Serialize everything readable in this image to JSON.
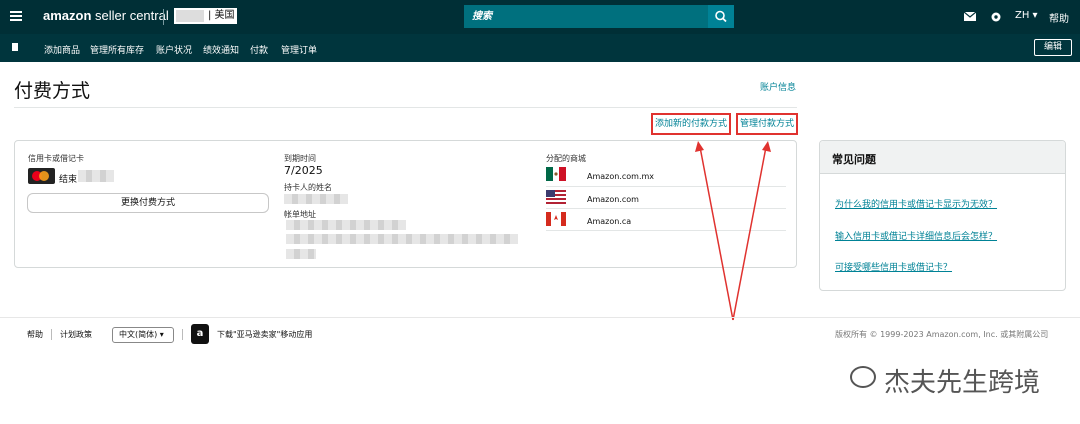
{
  "header": {
    "logo_text_1": "amazon",
    "logo_text_2": " seller central",
    "store_region": "| 美国",
    "search_placeholder": "搜索",
    "lang": "ZH ▾",
    "help": "帮助"
  },
  "nav": {
    "items": [
      "添加商品",
      "管理所有库存",
      "账户状况",
      "绩效通知",
      "付款",
      "管理订单"
    ],
    "edit": "编辑"
  },
  "page": {
    "title": "付费方式",
    "account_info": "账户信息",
    "add_method": "添加新的付款方式",
    "manage_method": "管理付款方式"
  },
  "card": {
    "cc_label": "信用卡或借记卡",
    "cc_ending": "结束",
    "replace_button": "更换付费方式",
    "expiry_label": "到期时间",
    "expiry_value": "7/2025",
    "holder_label": "持卡人的姓名",
    "billing_label": "帐单地址",
    "markets_label": "分配的商城",
    "markets": [
      "Amazon.com.mx",
      "Amazon.com",
      "Amazon.ca"
    ]
  },
  "faq": {
    "title": "常见问题",
    "links": [
      "为什么我的信用卡或借记卡显示为无效？",
      "输入信用卡或借记卡详细信息后会怎样？",
      "可接受哪些信用卡或借记卡？"
    ]
  },
  "footer": {
    "help": "帮助",
    "policy": "计划政策",
    "language": "中文(简体) ▾",
    "app": "下载\"亚马逊卖家\"移动应用",
    "copyright": "版权所有 © 1999-2023 Amazon.com, Inc. 或其附属公司"
  },
  "watermark": "杰夫先生跨境",
  "colors": {
    "header_bg": "#002f36",
    "nav_bg": "#00353d",
    "link": "#008296",
    "highlight": "#e0322f"
  }
}
